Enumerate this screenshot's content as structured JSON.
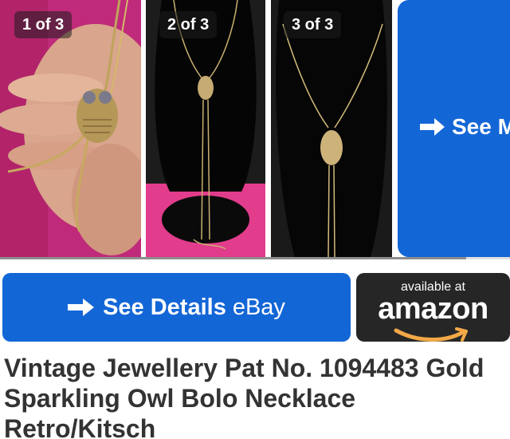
{
  "gallery": {
    "photos": [
      {
        "counter": "1 of 3"
      },
      {
        "counter": "2 of 3"
      },
      {
        "counter": "3 of 3"
      }
    ],
    "see_more_label": "See M"
  },
  "buttons": {
    "ebay": {
      "label_bold": "See Details",
      "label_light": "eBay",
      "color": "#1366d6"
    },
    "amazon": {
      "available_label": "available at",
      "brand_label": "amazon",
      "color": "#262626",
      "smile_color": "#f3a847"
    }
  },
  "product": {
    "title": "Vintage Jewellery Pat No. 1094483 Gold Sparkling Owl Bolo Necklace Retro/Kitsch"
  },
  "icons": [
    "arrow-right-icon",
    "amazon-smile-logo"
  ]
}
